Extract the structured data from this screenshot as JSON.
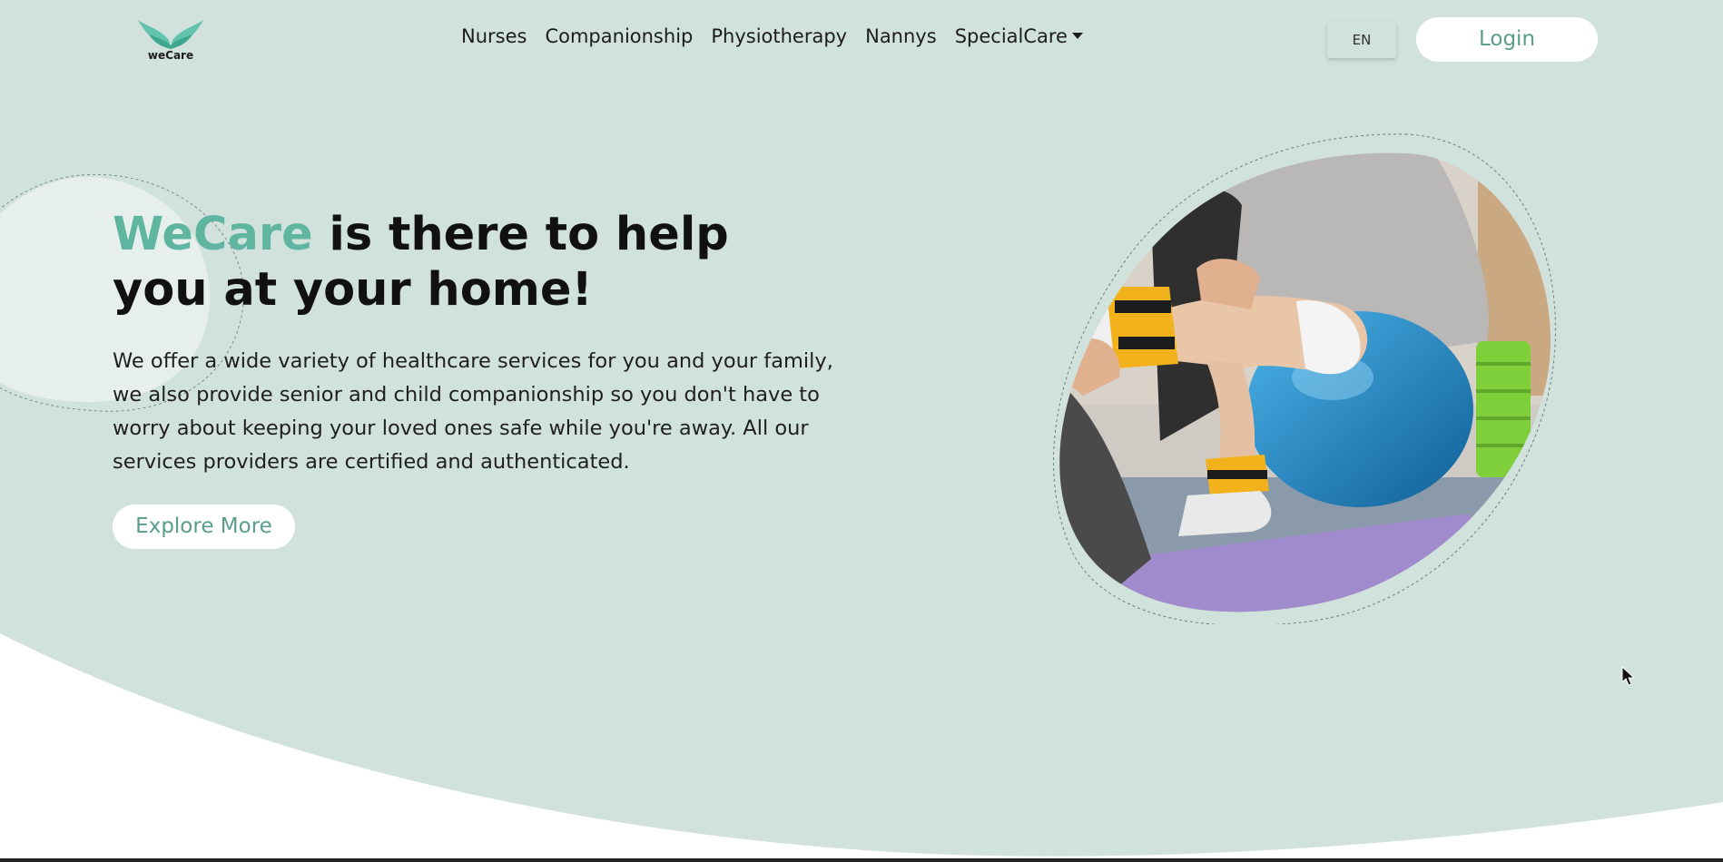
{
  "colors": {
    "hero_background": "#d1e2dc",
    "brand_accent": "#5fb5a0",
    "button_text": "#5a9d8c"
  },
  "brand": {
    "logo_text": "weCare"
  },
  "nav": {
    "items": [
      {
        "label": "Nurses"
      },
      {
        "label": "Companionship"
      },
      {
        "label": "Physiotherapy"
      },
      {
        "label": "Nannys"
      },
      {
        "label": "SpecialCare",
        "has_dropdown": true
      }
    ],
    "language": "EN",
    "login_label": "Login"
  },
  "hero": {
    "headline_brand": "WeCare",
    "headline_rest": " is there to help you at your home!",
    "description": "We offer a wide variety of healthcare services for you and your family, we also provide senior and child companionship so you don't have to worry about keeping your loved ones safe while you're away. All our services providers are certified and authenticated.",
    "cta_label": "Explore More",
    "image_alt": "Physiotherapist working with a patient's leg on a blue exercise ball"
  }
}
